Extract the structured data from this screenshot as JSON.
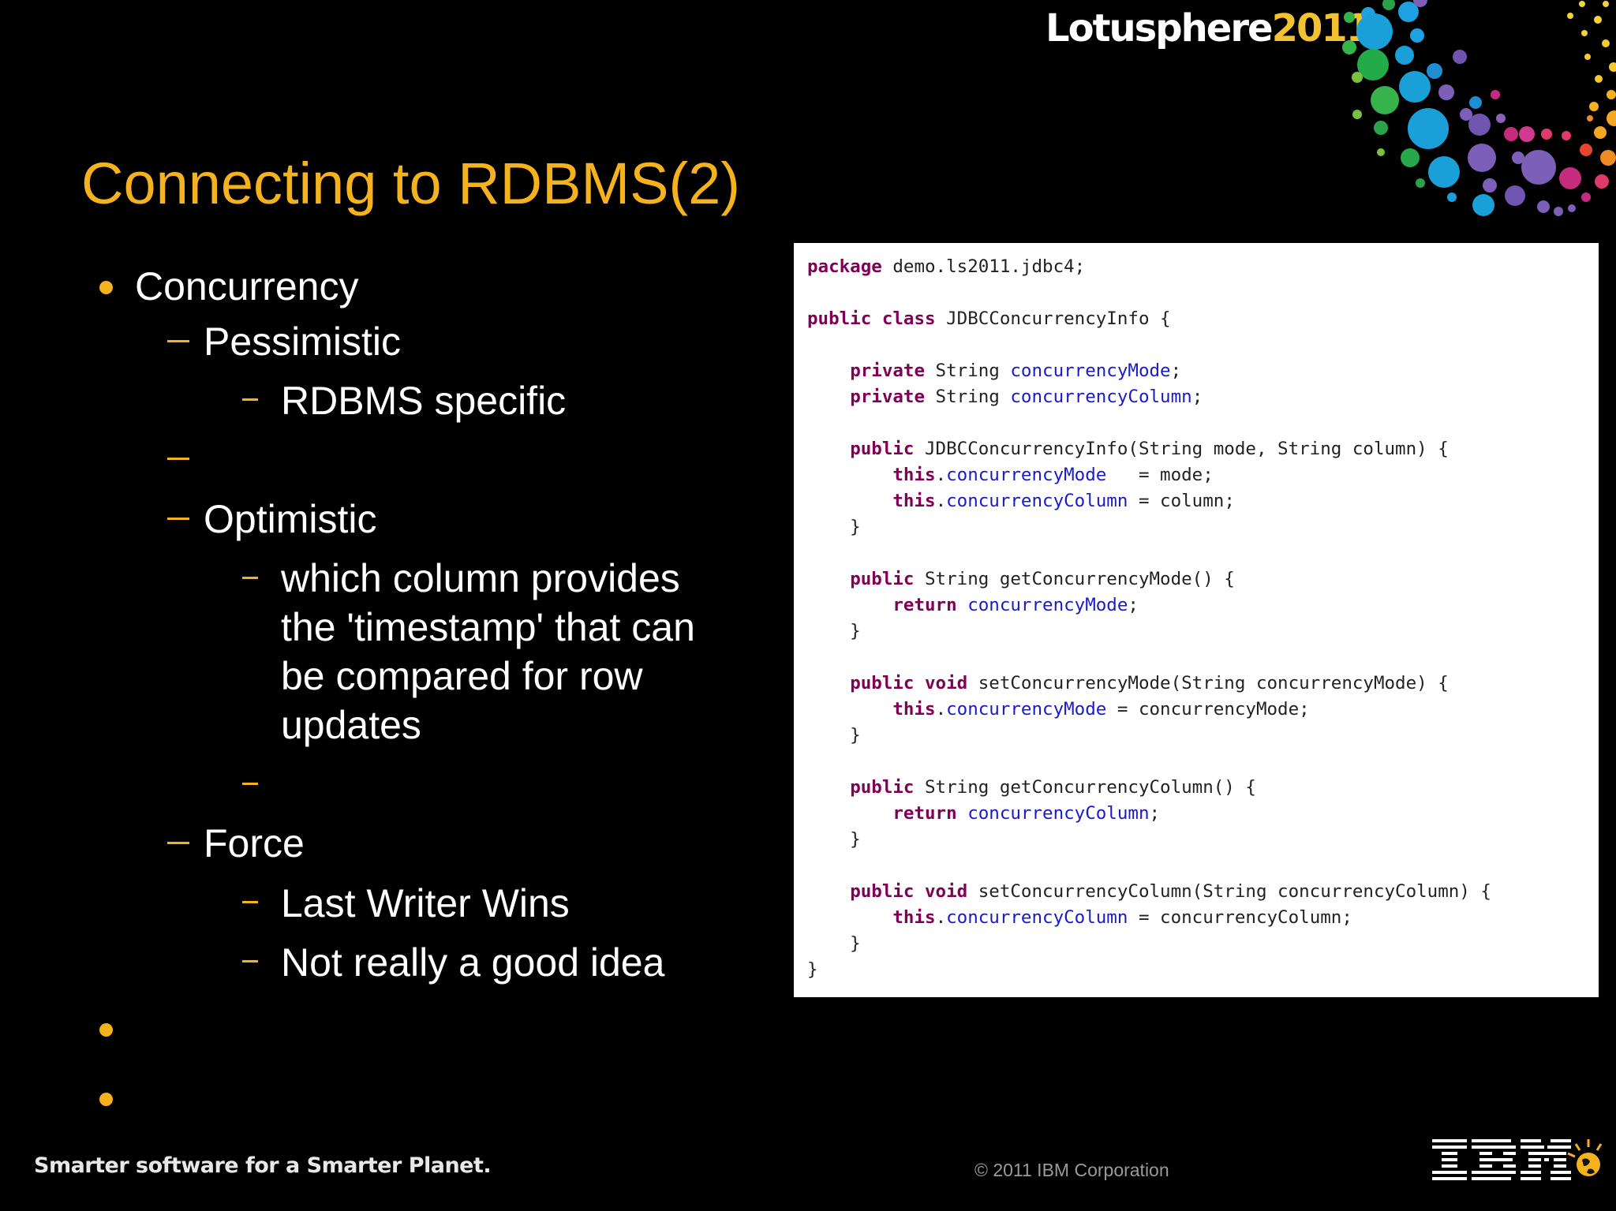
{
  "header": {
    "brand_name": "Lotusphere",
    "brand_year": "2011",
    "logo_icon": "lotusphere-dot-swirl-icon"
  },
  "title": "Connecting to RDBMS(2)",
  "bullets": {
    "concurrency": "Concurrency",
    "pessimistic": "Pessimistic",
    "rdbms_specific": "RDBMS specific",
    "optimistic": "Optimistic",
    "optimistic_detail": [
      "which column provides",
      "the 'timestamp' that can",
      "be compared for row",
      "updates"
    ],
    "force": "Force",
    "last_writer_wins": "Last Writer Wins",
    "not_good_idea": "Not really a good idea"
  },
  "code": {
    "package_kw": "package",
    "package_name": " demo.ls2011.jdbc4;",
    "lines": [
      "public class JDBCConcurrencyInfo {",
      "private String concurrencyMode;",
      "private String concurrencyColumn;",
      "public JDBCConcurrencyInfo(String mode, String column) {",
      "this.concurrencyMode   = mode;",
      "this.concurrencyColumn = column;",
      "public String getConcurrencyMode() {",
      "return concurrencyMode;",
      "public void setConcurrencyMode(String concurrencyMode) {",
      "this.concurrencyMode = concurrencyMode;",
      "public String getConcurrencyColumn() {",
      "return concurrencyColumn;",
      "public void setConcurrencyColumn(String concurrencyColumn) {",
      "this.concurrencyColumn = concurrencyColumn;"
    ]
  },
  "footer": {
    "tagline": "Smarter software for a Smarter Planet.",
    "copyright": "© 2011 IBM Corporation",
    "ibm_logo": "IBM",
    "logo_icon": "ibm-smarter-planet-icon"
  },
  "colors": {
    "accent": "#f5b21f",
    "background": "#000000",
    "keyword": "#7f0055",
    "field": "#1a1ac8"
  }
}
